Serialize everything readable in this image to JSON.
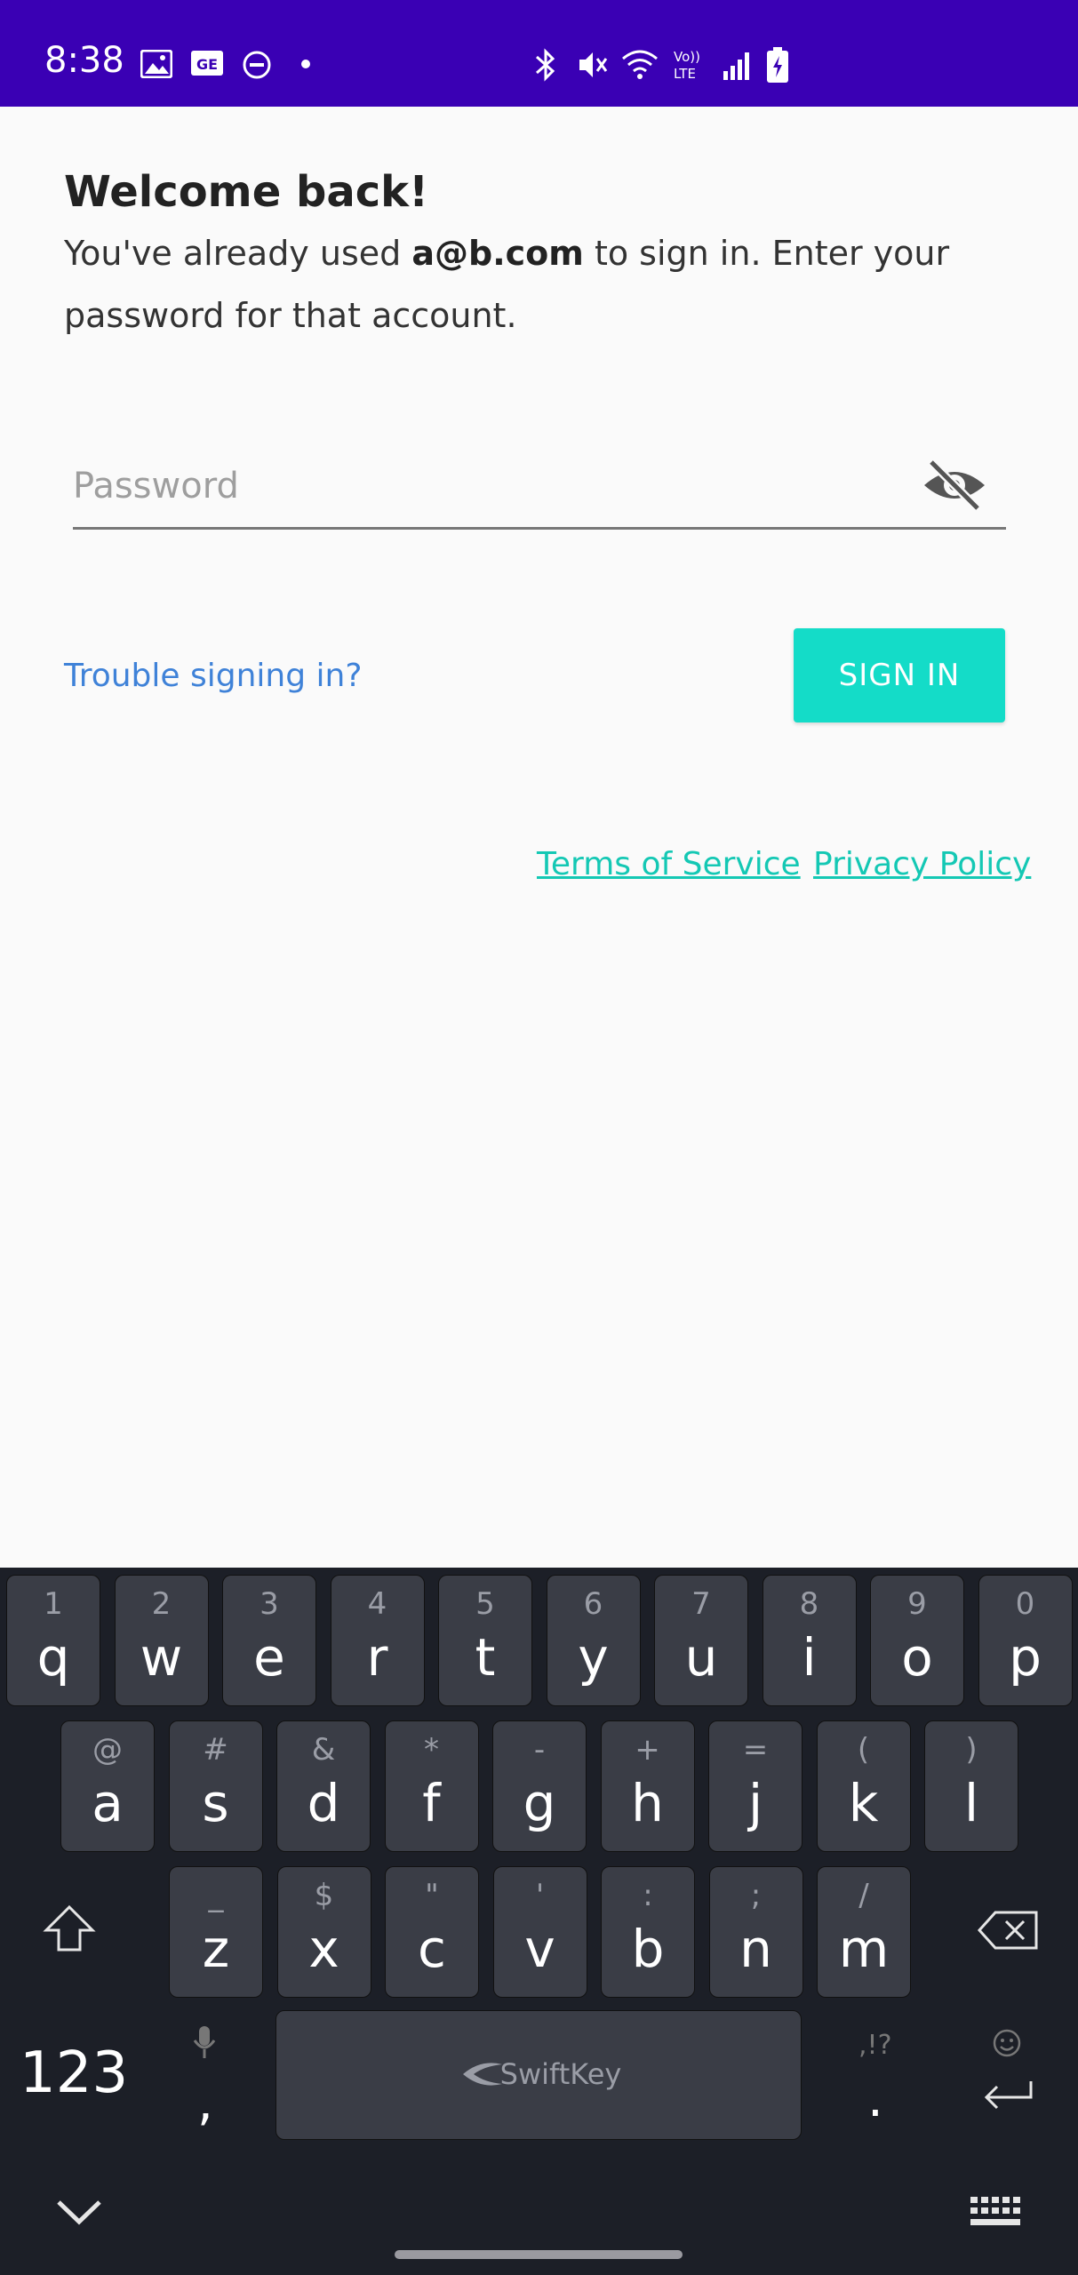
{
  "status_bar": {
    "time": "8:38",
    "bg_color": "#3a00b4",
    "icons": [
      "image-icon",
      "ge-icon",
      "dnd-icon",
      "dot-icon",
      "bluetooth-icon",
      "mute-icon",
      "wifi-icon",
      "volte-icon",
      "signal-icon",
      "battery-icon"
    ]
  },
  "welcome": {
    "title": "Welcome back!",
    "msg_prefix": "You've already used ",
    "email": "a@b.com",
    "msg_suffix": " to sign in. Enter your password for that account."
  },
  "password": {
    "placeholder": "Password",
    "value": ""
  },
  "actions": {
    "trouble": "Trouble signing in?",
    "sign_in": "SIGN IN",
    "accent_color": "#14dcc8"
  },
  "footer": {
    "terms": "Terms of Service",
    "privacy": "Privacy Policy"
  },
  "keyboard": {
    "row1": [
      {
        "hint": "1",
        "key": "q"
      },
      {
        "hint": "2",
        "key": "w"
      },
      {
        "hint": "3",
        "key": "e"
      },
      {
        "hint": "4",
        "key": "r"
      },
      {
        "hint": "5",
        "key": "t"
      },
      {
        "hint": "6",
        "key": "y"
      },
      {
        "hint": "7",
        "key": "u"
      },
      {
        "hint": "8",
        "key": "i"
      },
      {
        "hint": "9",
        "key": "o"
      },
      {
        "hint": "0",
        "key": "p"
      }
    ],
    "row2": [
      {
        "hint": "@",
        "key": "a"
      },
      {
        "hint": "#",
        "key": "s"
      },
      {
        "hint": "&",
        "key": "d"
      },
      {
        "hint": "*",
        "key": "f"
      },
      {
        "hint": "-",
        "key": "g"
      },
      {
        "hint": "+",
        "key": "h"
      },
      {
        "hint": "=",
        "key": "j"
      },
      {
        "hint": "(",
        "key": "k"
      },
      {
        "hint": ")",
        "key": "l"
      }
    ],
    "row3": [
      {
        "hint": "_",
        "key": "z"
      },
      {
        "hint": "$",
        "key": "x"
      },
      {
        "hint": "\"",
        "key": "c"
      },
      {
        "hint": "'",
        "key": "v"
      },
      {
        "hint": ":",
        "key": "b"
      },
      {
        "hint": ";",
        "key": "n"
      },
      {
        "hint": "/",
        "key": "m"
      }
    ],
    "numbers_label": "123",
    "comma": ",",
    "period": ".",
    "period_hint": ",!?",
    "space_label": "SwiftKey"
  }
}
